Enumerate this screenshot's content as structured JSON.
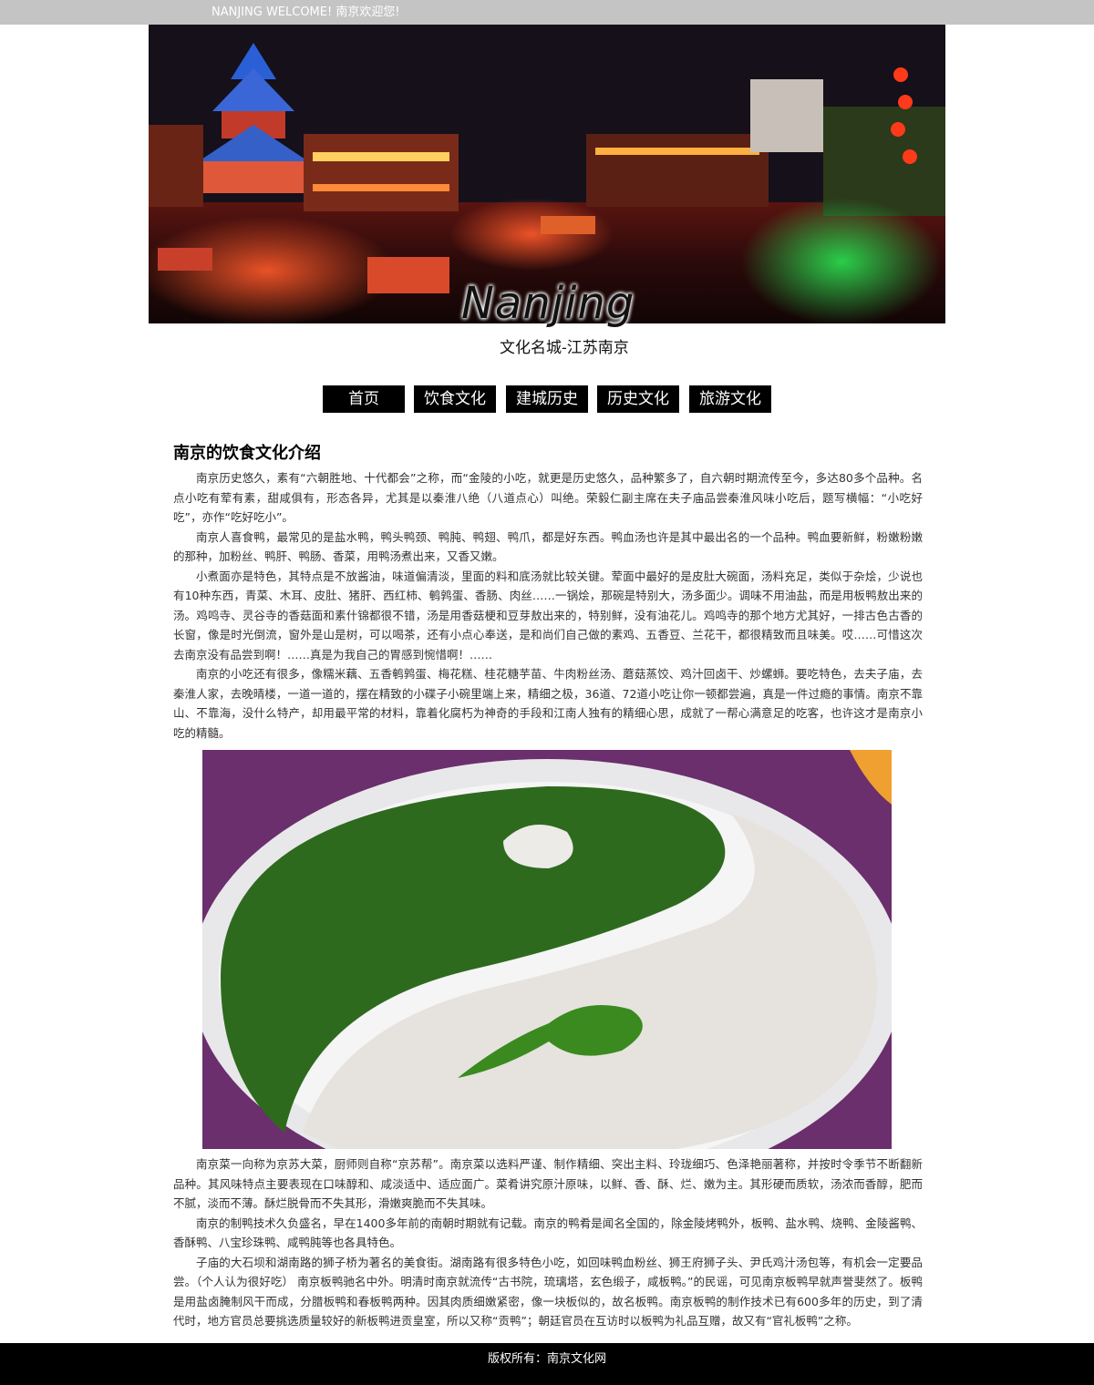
{
  "topbar": {
    "welcome": "NANJING WELCOME! 南京欢迎您!"
  },
  "banner": {
    "logo_word": "Nanjing",
    "subtitle": "文化名城-江苏南京"
  },
  "nav": {
    "items": [
      "首页",
      "饮食文化",
      "建城历史",
      "历史文化",
      "旅游文化"
    ]
  },
  "article": {
    "title": "南京的饮食文化介绍",
    "paragraphs_before": [
      "南京历史悠久，素有“六朝胜地、十代都会”之称，而“金陵的小吃，就更是历史悠久，品种繁多了，自六朝时期流传至今，多达80多个品种。名点小吃有荤有素，甜咸俱有，形态各异，尤其是以秦淮八绝（八道点心）叫绝。荣毅仁副主席在夫子庙品尝秦淮风味小吃后，题写横幅：“小吃好吃”，亦作“吃好吃小”。",
      "南京人喜食鸭，最常见的是盐水鸭，鸭头鸭颈、鸭肫、鸭翅、鸭爪，都是好东西。鸭血汤也许是其中最出名的一个品种。鸭血要新鲜，粉嫩粉嫩的那种，加粉丝、鸭肝、鸭肠、香菜，用鸭汤煮出来，又香又嫩。",
      "小煮面亦是特色，其特点是不放酱油，味道偏清淡，里面的料和底汤就比较关键。荤面中最好的是皮肚大碗面，汤料充足，类似于杂烩，少说也有10种东西，青菜、木耳、皮肚、猪肝、西红柿、鹌鹑蛋、香肠、肉丝……一锅烩，那碗是特别大，汤多面少。调味不用油盐，而是用板鸭敖出来的汤。鸡鸣寺、灵谷寺的香菇面和素什锦都很不错，汤是用香菇梗和豆芽敖出来的，特别鲜，没有油花儿。鸡鸣寺的那个地方尤其好，一排古色古香的长窗，像是时光倒流，窗外是山是树，可以喝茶，还有小点心奉送，是和尚们自己做的素鸡、五香豆、兰花干，都很精致而且味美。哎……可惜这次去南京没有品尝到啊！……真是为我自己的胃感到惋惜啊！……",
      "南京的小吃还有很多，像糯米藕、五香鹌鹑蛋、梅花糕、桂花糖芋苗、牛肉粉丝汤、蘑菇蒸饺、鸡汁回卤干、炒螺蛳。要吃特色，去夫子庙，去秦淮人家，去晚晴楼，一道一道的，摆在精致的小碟子小碗里端上来，精细之极，36道、72道小吃让你一顿都尝遍，真是一件过瘾的事情。南京不靠山、不靠海，没什么特产，却用最平常的材料，靠着化腐朽为神奇的手段和江南人独有的精细心思，成就了一帮心满意足的吃客，也许这才是南京小吃的精髓。"
    ],
    "paragraphs_after": [
      "南京菜一向称为京苏大菜，厨师则自称“京苏帮”。南京菜以选料严谨、制作精细、突出主料、玲珑细巧、色泽艳丽著称，并按时令季节不断翻新品种。其风味特点主要表现在口味醇和、咸淡适中、适应面广。菜肴讲究原汁原味，以鲜、香、酥、烂、嫩为主。其形硬而质软，汤浓而香醇，肥而不腻，淡而不薄。酥烂脱骨而不失其形，滑嫩爽脆而不失其味。",
      "南京的制鸭技术久负盛名，早在1400多年前的南朝时期就有记载。南京的鸭肴是闻名全国的，除金陵烤鸭外，板鸭、盐水鸭、烧鸭、金陵酱鸭、香酥鸭、八宝珍珠鸭、咸鸭肫等也各具特色。",
      "子庙的大石坝和湖南路的狮子桥为著名的美食街。湖南路有很多特色小吃，如回味鸭血粉丝、狮王府狮子头、尹氏鸡汁汤包等，有机会一定要品尝。（个人认为很好吃） 南京板鸭驰名中外。明清时南京就流传“古书院，琉璃塔，玄色缎子，咸板鸭。”的民谣，可见南京板鸭早就声誉斐然了。板鸭是用盐卤腌制风干而成，分腊板鸭和春板鸭两种。因其肉质细嫩紧密，像一块板似的，故名板鸭。南京板鸭的制作技术已有600多年的历史，到了清代时，地方官员总要挑选质量较好的新板鸭进贡皇室，所以又称“贡鸭”；朝廷官员在互访时以板鸭为礼品互赠，故又有“官礼板鸭”之称。"
    ]
  },
  "footer": {
    "copyright": "版权所有：南京文化网"
  }
}
